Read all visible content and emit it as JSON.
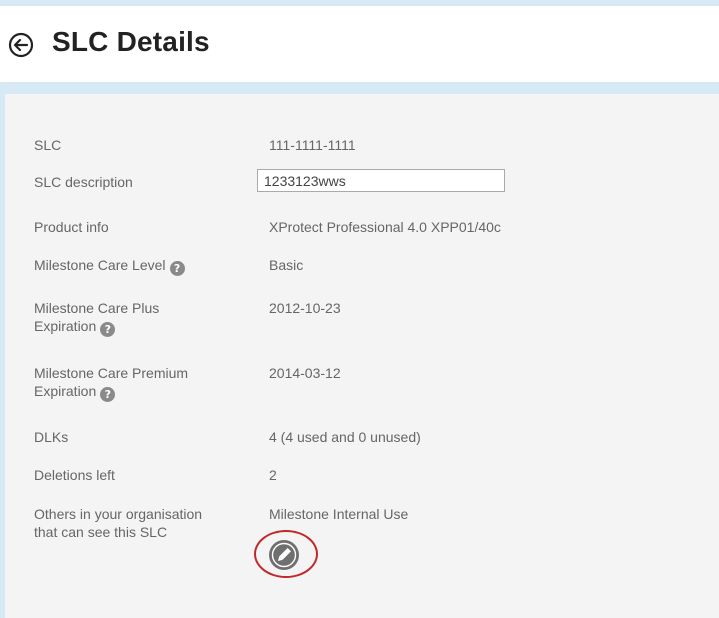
{
  "header": {
    "title": "SLC Details",
    "back_icon": "back-arrow-circle-icon"
  },
  "details": {
    "slc": {
      "label": "SLC",
      "value": "111-1111-1111"
    },
    "description": {
      "label": "SLC description",
      "value": "1233123wws"
    },
    "product": {
      "label": "Product info",
      "value": "XProtect Professional 4.0 XPP01/40c"
    },
    "care_level": {
      "label": "Milestone Care Level",
      "value": "Basic",
      "help_glyph": "?"
    },
    "care_plus": {
      "label_line1": "Milestone Care Plus",
      "label_line2": "Expiration",
      "value": "2012-10-23",
      "help_glyph": "?"
    },
    "care_premium": {
      "label_line1": "Milestone Care Premium",
      "label_line2": "Expiration",
      "value": "2014-03-12",
      "help_glyph": "?"
    },
    "dlks": {
      "label": "DLKs",
      "value": "4 (4 used and 0 unused)"
    },
    "deletions": {
      "label": "Deletions left",
      "value": "2"
    },
    "others": {
      "label_line1": "Others in your organisation",
      "label_line2": "that can see this SLC",
      "value": "Milestone Internal Use",
      "edit_icon": "pencil-icon"
    }
  },
  "colors": {
    "background": "#d8e9f6",
    "panel": "#f4f4f4",
    "text": "#666666",
    "title": "#222222",
    "highlight_ring": "#c0282a"
  }
}
